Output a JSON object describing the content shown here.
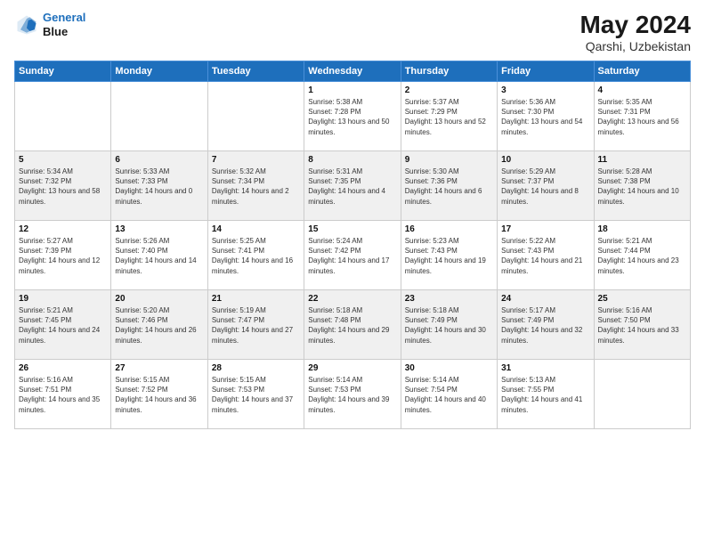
{
  "logo": {
    "line1": "General",
    "line2": "Blue"
  },
  "title": "May 2024",
  "subtitle": "Qarshi, Uzbekistan",
  "weekdays": [
    "Sunday",
    "Monday",
    "Tuesday",
    "Wednesday",
    "Thursday",
    "Friday",
    "Saturday"
  ],
  "weeks": [
    [
      {
        "day": "",
        "sunrise": "",
        "sunset": "",
        "daylight": ""
      },
      {
        "day": "",
        "sunrise": "",
        "sunset": "",
        "daylight": ""
      },
      {
        "day": "",
        "sunrise": "",
        "sunset": "",
        "daylight": ""
      },
      {
        "day": "1",
        "sunrise": "Sunrise: 5:38 AM",
        "sunset": "Sunset: 7:28 PM",
        "daylight": "Daylight: 13 hours and 50 minutes."
      },
      {
        "day": "2",
        "sunrise": "Sunrise: 5:37 AM",
        "sunset": "Sunset: 7:29 PM",
        "daylight": "Daylight: 13 hours and 52 minutes."
      },
      {
        "day": "3",
        "sunrise": "Sunrise: 5:36 AM",
        "sunset": "Sunset: 7:30 PM",
        "daylight": "Daylight: 13 hours and 54 minutes."
      },
      {
        "day": "4",
        "sunrise": "Sunrise: 5:35 AM",
        "sunset": "Sunset: 7:31 PM",
        "daylight": "Daylight: 13 hours and 56 minutes."
      }
    ],
    [
      {
        "day": "5",
        "sunrise": "Sunrise: 5:34 AM",
        "sunset": "Sunset: 7:32 PM",
        "daylight": "Daylight: 13 hours and 58 minutes."
      },
      {
        "day": "6",
        "sunrise": "Sunrise: 5:33 AM",
        "sunset": "Sunset: 7:33 PM",
        "daylight": "Daylight: 14 hours and 0 minutes."
      },
      {
        "day": "7",
        "sunrise": "Sunrise: 5:32 AM",
        "sunset": "Sunset: 7:34 PM",
        "daylight": "Daylight: 14 hours and 2 minutes."
      },
      {
        "day": "8",
        "sunrise": "Sunrise: 5:31 AM",
        "sunset": "Sunset: 7:35 PM",
        "daylight": "Daylight: 14 hours and 4 minutes."
      },
      {
        "day": "9",
        "sunrise": "Sunrise: 5:30 AM",
        "sunset": "Sunset: 7:36 PM",
        "daylight": "Daylight: 14 hours and 6 minutes."
      },
      {
        "day": "10",
        "sunrise": "Sunrise: 5:29 AM",
        "sunset": "Sunset: 7:37 PM",
        "daylight": "Daylight: 14 hours and 8 minutes."
      },
      {
        "day": "11",
        "sunrise": "Sunrise: 5:28 AM",
        "sunset": "Sunset: 7:38 PM",
        "daylight": "Daylight: 14 hours and 10 minutes."
      }
    ],
    [
      {
        "day": "12",
        "sunrise": "Sunrise: 5:27 AM",
        "sunset": "Sunset: 7:39 PM",
        "daylight": "Daylight: 14 hours and 12 minutes."
      },
      {
        "day": "13",
        "sunrise": "Sunrise: 5:26 AM",
        "sunset": "Sunset: 7:40 PM",
        "daylight": "Daylight: 14 hours and 14 minutes."
      },
      {
        "day": "14",
        "sunrise": "Sunrise: 5:25 AM",
        "sunset": "Sunset: 7:41 PM",
        "daylight": "Daylight: 14 hours and 16 minutes."
      },
      {
        "day": "15",
        "sunrise": "Sunrise: 5:24 AM",
        "sunset": "Sunset: 7:42 PM",
        "daylight": "Daylight: 14 hours and 17 minutes."
      },
      {
        "day": "16",
        "sunrise": "Sunrise: 5:23 AM",
        "sunset": "Sunset: 7:43 PM",
        "daylight": "Daylight: 14 hours and 19 minutes."
      },
      {
        "day": "17",
        "sunrise": "Sunrise: 5:22 AM",
        "sunset": "Sunset: 7:43 PM",
        "daylight": "Daylight: 14 hours and 21 minutes."
      },
      {
        "day": "18",
        "sunrise": "Sunrise: 5:21 AM",
        "sunset": "Sunset: 7:44 PM",
        "daylight": "Daylight: 14 hours and 23 minutes."
      }
    ],
    [
      {
        "day": "19",
        "sunrise": "Sunrise: 5:21 AM",
        "sunset": "Sunset: 7:45 PM",
        "daylight": "Daylight: 14 hours and 24 minutes."
      },
      {
        "day": "20",
        "sunrise": "Sunrise: 5:20 AM",
        "sunset": "Sunset: 7:46 PM",
        "daylight": "Daylight: 14 hours and 26 minutes."
      },
      {
        "day": "21",
        "sunrise": "Sunrise: 5:19 AM",
        "sunset": "Sunset: 7:47 PM",
        "daylight": "Daylight: 14 hours and 27 minutes."
      },
      {
        "day": "22",
        "sunrise": "Sunrise: 5:18 AM",
        "sunset": "Sunset: 7:48 PM",
        "daylight": "Daylight: 14 hours and 29 minutes."
      },
      {
        "day": "23",
        "sunrise": "Sunrise: 5:18 AM",
        "sunset": "Sunset: 7:49 PM",
        "daylight": "Daylight: 14 hours and 30 minutes."
      },
      {
        "day": "24",
        "sunrise": "Sunrise: 5:17 AM",
        "sunset": "Sunset: 7:49 PM",
        "daylight": "Daylight: 14 hours and 32 minutes."
      },
      {
        "day": "25",
        "sunrise": "Sunrise: 5:16 AM",
        "sunset": "Sunset: 7:50 PM",
        "daylight": "Daylight: 14 hours and 33 minutes."
      }
    ],
    [
      {
        "day": "26",
        "sunrise": "Sunrise: 5:16 AM",
        "sunset": "Sunset: 7:51 PM",
        "daylight": "Daylight: 14 hours and 35 minutes."
      },
      {
        "day": "27",
        "sunrise": "Sunrise: 5:15 AM",
        "sunset": "Sunset: 7:52 PM",
        "daylight": "Daylight: 14 hours and 36 minutes."
      },
      {
        "day": "28",
        "sunrise": "Sunrise: 5:15 AM",
        "sunset": "Sunset: 7:53 PM",
        "daylight": "Daylight: 14 hours and 37 minutes."
      },
      {
        "day": "29",
        "sunrise": "Sunrise: 5:14 AM",
        "sunset": "Sunset: 7:53 PM",
        "daylight": "Daylight: 14 hours and 39 minutes."
      },
      {
        "day": "30",
        "sunrise": "Sunrise: 5:14 AM",
        "sunset": "Sunset: 7:54 PM",
        "daylight": "Daylight: 14 hours and 40 minutes."
      },
      {
        "day": "31",
        "sunrise": "Sunrise: 5:13 AM",
        "sunset": "Sunset: 7:55 PM",
        "daylight": "Daylight: 14 hours and 41 minutes."
      },
      {
        "day": "",
        "sunrise": "",
        "sunset": "",
        "daylight": ""
      }
    ]
  ]
}
